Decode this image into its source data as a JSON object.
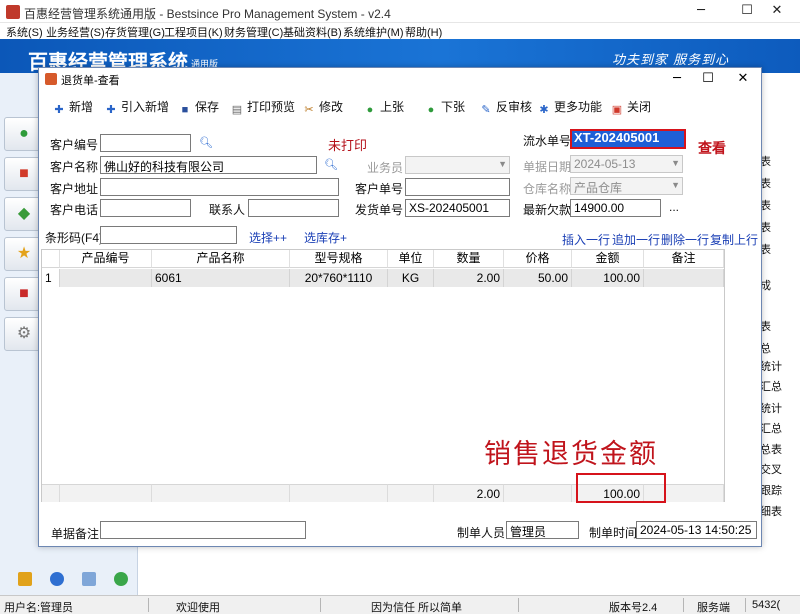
{
  "app": {
    "window_title": "百惠经营管理系统通用版 - Bestsince Pro Management System - v2.4",
    "banner_name": "百惠经营管理系统",
    "banner_edition": "通用版",
    "banner_slogan": "功夫到家 服务到心"
  },
  "window_controls": {
    "minimize": "─",
    "maximize": "☐",
    "close": "✕"
  },
  "menu": [
    "系统(S)",
    "业务经营(S)",
    "存货管理(G)",
    "工程项目(K)",
    "财务管理(C)",
    "基础资料(B)",
    "系统维护(M)",
    "帮助(H)"
  ],
  "right_labels": [
    "表",
    "表",
    "表",
    "表",
    "表",
    "成",
    "表",
    "总",
    "统计",
    "汇总",
    "统计",
    "汇总",
    "总表",
    "交叉",
    "跟踪",
    "细表"
  ],
  "statusbar": {
    "user": "用户名:管理员",
    "welcome": "欢迎使用",
    "motto": "因为信任 所以简单",
    "version": "版本号2.4",
    "server": "服务端",
    "extra": "5432("
  },
  "dialog": {
    "title": "退货单-查看",
    "controls": {
      "minimize": "─",
      "maximize": "☐",
      "close": "✕"
    },
    "toolbar": [
      {
        "label": "新增",
        "icon": "add-icon"
      },
      {
        "label": "引入新增",
        "icon": "import-add-icon"
      },
      {
        "label": "保存",
        "icon": "save-icon"
      },
      {
        "label": "打印预览",
        "icon": "print-preview-icon"
      },
      {
        "label": "修改",
        "icon": "edit-icon"
      },
      {
        "label": "上张",
        "icon": "previous-icon"
      },
      {
        "label": "下张",
        "icon": "next-icon"
      },
      {
        "label": "反审核",
        "icon": "unaudit-icon"
      },
      {
        "label": "更多功能",
        "icon": "more-functions-icon"
      },
      {
        "label": "关闭",
        "icon": "close-icon"
      }
    ],
    "status_text": "未打印",
    "mode_text": "查看",
    "form": {
      "customer_code_label": "客户编号",
      "customer_code": "",
      "customer_name_label": "客户名称",
      "customer_name": "佛山好的科技有限公司",
      "customer_address_label": "客户地址",
      "customer_address": "",
      "customer_phone_label": "客户电话",
      "customer_phone": "",
      "contact_label": "联系人",
      "contact": "",
      "salesman_label": "业务员",
      "salesman": "",
      "customer_order_label": "客户单号",
      "customer_order": "",
      "ship_no_label": "发货单号",
      "ship_no": "XS-202405001",
      "serial_label": "流水单号",
      "serial": "XT-202405001",
      "date_label": "单据日期",
      "date": "2024-05-13",
      "warehouse_label": "仓库名称",
      "warehouse": "产品仓库",
      "latest_debt_label": "最新欠款",
      "latest_debt": "14900.00",
      "ellipsis": "...",
      "barcode_label": "条形码(F4)",
      "barcode": "",
      "select_label": "选择++",
      "select_stock_label": "选库存+",
      "insert_row": "插入一行",
      "append_row": "追加一行",
      "delete_row": "删除一行",
      "copy_row": "复制上行"
    },
    "grid": {
      "columns": [
        "",
        "产品编号",
        "产品名称",
        "型号规格",
        "单位",
        "数量",
        "价格",
        "金额",
        "备注"
      ],
      "rows": [
        [
          "1",
          "",
          "6061",
          "20*760*1110",
          "KG",
          "2.00",
          "50.00",
          "100.00",
          ""
        ]
      ],
      "totals": {
        "quantity": "2.00",
        "amount": "100.00"
      }
    },
    "annotation": "销售退货金额",
    "footer": {
      "remark_label": "单据备注",
      "remark": "",
      "maker_label": "制单人员",
      "maker": "管理员",
      "time_label": "制单时间",
      "time": "2024-05-13 14:50:25"
    }
  },
  "colors": {
    "banner_blue": "#1a74d6",
    "annotation_red": "#c0141c",
    "link_blue": "#1a3fb5",
    "status_red": "#b5121b"
  }
}
